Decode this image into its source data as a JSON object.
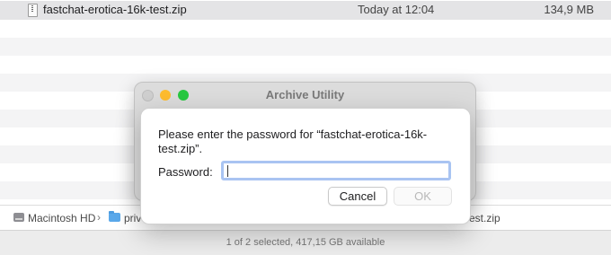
{
  "file_list": {
    "selected_file": {
      "name": "fastchat-erotica-16k-test.zip",
      "date_modified": "Today at 12:04",
      "size": "134,9 MB",
      "icon": "zip-file-icon"
    }
  },
  "path_bar": {
    "drive": "Macintosh HD",
    "drive_icon": "hard-drive-icon",
    "separator": "›",
    "folder": "priv",
    "folder_icon": "folder-icon",
    "file_tail": "est.zip"
  },
  "status_bar": {
    "text": "1 of 2 selected, 417,15 GB available"
  },
  "archive_window": {
    "title": "Archive Utility"
  },
  "password_dialog": {
    "prompt": "Please enter the password for “fastchat-erotica-16k-test.zip”.",
    "password_label": "Password:",
    "password_value": "",
    "cancel_label": "Cancel",
    "ok_label": "OK"
  },
  "colors": {
    "focus_ring": "#a9c4f2",
    "traffic_min": "#febc2e",
    "traffic_max": "#28c840",
    "folder": "#5aa8ea"
  }
}
